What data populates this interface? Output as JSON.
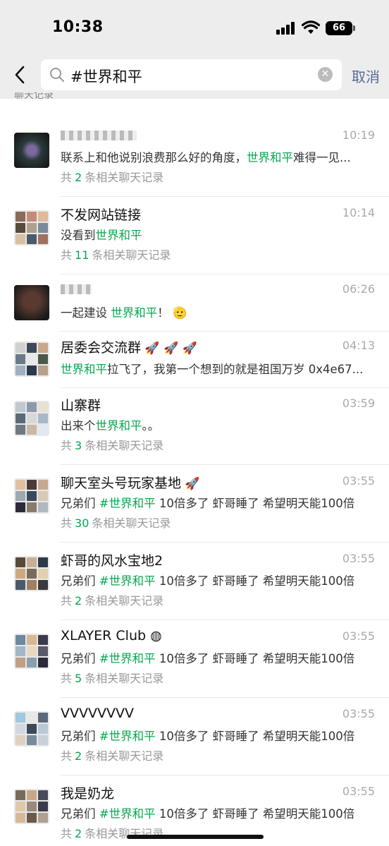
{
  "status": {
    "time": "10:38",
    "battery": "66"
  },
  "search": {
    "value": "#世界和平",
    "cancel_label": "取消"
  },
  "section_title": "聊天记录",
  "results": [
    {
      "name": "",
      "time": "10:19",
      "msg_before": "联系上和他说别浪费那么好的角度，",
      "keyword": "世界和平",
      "msg_after": "难得一见...",
      "count_prefix": "共",
      "count": "2",
      "count_suffix": "条相关聊天记录"
    },
    {
      "name": "不发网站链接",
      "time": "10:14",
      "msg_before": "没看到",
      "keyword": "世界和平",
      "msg_after": "",
      "count_prefix": "共",
      "count": "11",
      "count_suffix": "条相关聊天记录"
    },
    {
      "name": "",
      "time": "06:26",
      "msg_before": "一起建设 ",
      "keyword": "世界和平",
      "msg_after": "！",
      "count_prefix": "",
      "count": "",
      "count_suffix": ""
    },
    {
      "name": "居委会交流群",
      "time": "04:13",
      "msg_before": "",
      "keyword": "世界和平",
      "msg_after": "拉飞了，我第一个想到的就是祖国万岁 0x4e67...",
      "count_prefix": "",
      "count": "",
      "count_suffix": ""
    },
    {
      "name": "山寨群",
      "time": "03:59",
      "msg_before": "出来个",
      "keyword": "世界和平",
      "msg_after": "。。",
      "count_prefix": "共",
      "count": "3",
      "count_suffix": "条相关聊天记录"
    },
    {
      "name": "聊天室头号玩家基地",
      "time": "03:55",
      "msg_before": "兄弟们 ",
      "keyword": "#世界和平",
      "msg_after": " 10倍多了 虾哥睡了 希望明天能100倍",
      "count_prefix": "共",
      "count": "30",
      "count_suffix": "条相关聊天记录"
    },
    {
      "name": "虾哥的风水宝地2",
      "time": "03:55",
      "msg_before": "兄弟们 ",
      "keyword": "#世界和平",
      "msg_after": " 10倍多了 虾哥睡了 希望明天能100倍",
      "count_prefix": "共",
      "count": "2",
      "count_suffix": "条相关聊天记录"
    },
    {
      "name": "XLAYER Club",
      "time": "03:55",
      "msg_before": "兄弟们 ",
      "keyword": "#世界和平",
      "msg_after": " 10倍多了 虾哥睡了 希望明天能100倍",
      "count_prefix": "共",
      "count": "5",
      "count_suffix": "条相关聊天记录"
    },
    {
      "name": "VVVVVVVV",
      "time": "03:55",
      "msg_before": "兄弟们 ",
      "keyword": "#世界和平",
      "msg_after": " 10倍多了 虾哥睡了 希望明天能100倍",
      "count_prefix": "共",
      "count": "2",
      "count_suffix": "条相关聊天记录"
    },
    {
      "name": "我是奶龙",
      "time": "03:55",
      "msg_before": "兄弟们 ",
      "keyword": "#世界和平",
      "msg_after": " 10倍多了 虾哥睡了 希望明天能100倍",
      "count_prefix": "共",
      "count": "2",
      "count_suffix": "条相关聊天记录"
    }
  ],
  "colors": {
    "highlight": "#07a750",
    "link": "#576b95",
    "top_bg": "#ededed"
  },
  "icons": {
    "back": "chevron-left-icon",
    "search": "search-icon",
    "clear": "clear-icon"
  }
}
